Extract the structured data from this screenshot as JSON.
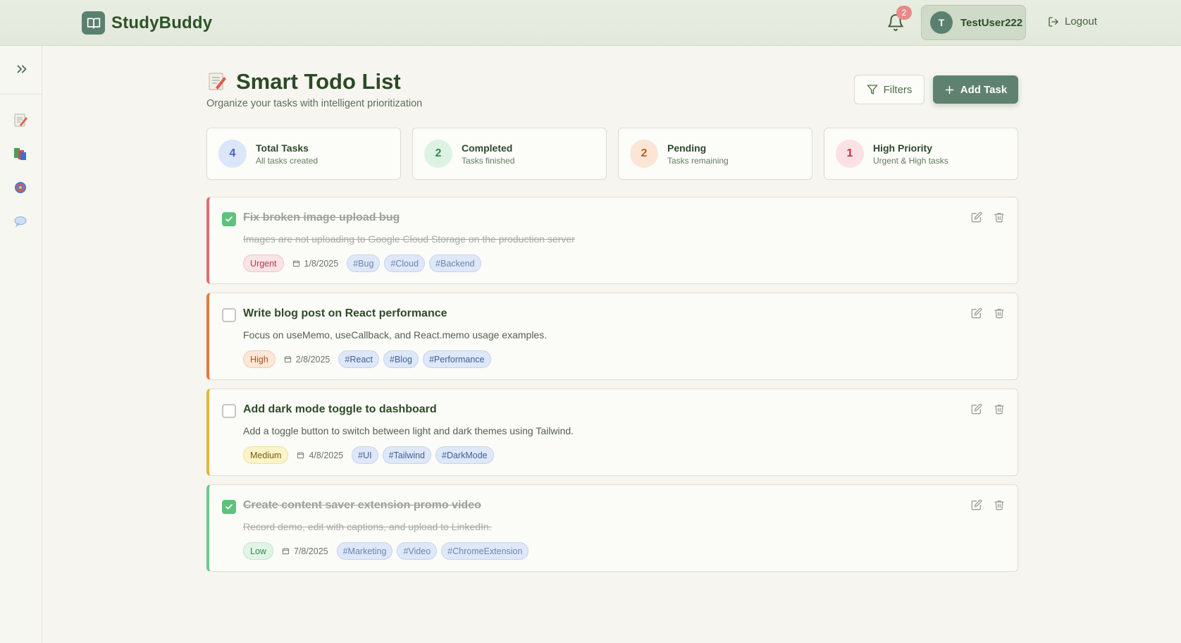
{
  "header": {
    "brand": "StudyBuddy",
    "notification_count": "2",
    "user_initial": "T",
    "user_name": "TestUser222",
    "logout_label": "Logout"
  },
  "sidebar": {
    "items": [
      {
        "icon": "memo-icon"
      },
      {
        "icon": "books-icon"
      },
      {
        "icon": "globe-icon"
      },
      {
        "icon": "speech-bubble-icon"
      }
    ]
  },
  "page": {
    "title": "Smart Todo List",
    "subtitle": "Organize your tasks with intelligent prioritization",
    "filters_label": "Filters",
    "add_task_label": "Add Task"
  },
  "stats": [
    {
      "value": "4",
      "label": "Total Tasks",
      "sub": "All tasks created",
      "color": "#3b63c9",
      "bg": "#dce6fa"
    },
    {
      "value": "2",
      "label": "Completed",
      "sub": "Tasks finished",
      "color": "#2f8a4d",
      "bg": "#dcf3e3"
    },
    {
      "value": "2",
      "label": "Pending",
      "sub": "Tasks remaining",
      "color": "#c25a20",
      "bg": "#fbe6d6"
    },
    {
      "value": "1",
      "label": "High Priority",
      "sub": "Urgent & High tasks",
      "color": "#c52f45",
      "bg": "#fbe0e4"
    }
  ],
  "tasks": [
    {
      "title": "Fix broken image upload bug",
      "description": "Images are not uploading to Google Cloud Storage on the production server",
      "priority": "Urgent",
      "date": "1/8/2025",
      "tags": [
        "#Bug",
        "#Cloud",
        "#Backend"
      ],
      "completed": true,
      "accent": "#e26b6b"
    },
    {
      "title": "Write blog post on React performance",
      "description": "Focus on useMemo, useCallback, and React.memo usage examples.",
      "priority": "High",
      "date": "2/8/2025",
      "tags": [
        "#React",
        "#Blog",
        "#Performance"
      ],
      "completed": false,
      "accent": "#e8783a"
    },
    {
      "title": "Add dark mode toggle to dashboard",
      "description": "Add a toggle button to switch between light and dark themes using Tailwind.",
      "priority": "Medium",
      "date": "4/8/2025",
      "tags": [
        "#UI",
        "#Tailwind",
        "#DarkMode"
      ],
      "completed": false,
      "accent": "#e3b43a"
    },
    {
      "title": "Create content saver extension promo video",
      "description": "Record demo, edit with captions, and upload to LinkedIn.",
      "priority": "Low",
      "date": "7/8/2025",
      "tags": [
        "#Marketing",
        "#Video",
        "#ChromeExtension"
      ],
      "completed": true,
      "accent": "#6cc98a"
    }
  ],
  "priority_styles": {
    "Urgent": {
      "bg": "#fbe3e6",
      "border": "#f3c3ca",
      "color": "#b8384a"
    },
    "High": {
      "bg": "#fde8d8",
      "border": "#f5cbaa",
      "color": "#a84f1a"
    },
    "Medium": {
      "bg": "#fdf3c8",
      "border": "#f1e098",
      "color": "#7a5c0d"
    },
    "Low": {
      "bg": "#e0f5e6",
      "border": "#bfe6cb",
      "color": "#3b8252"
    }
  }
}
